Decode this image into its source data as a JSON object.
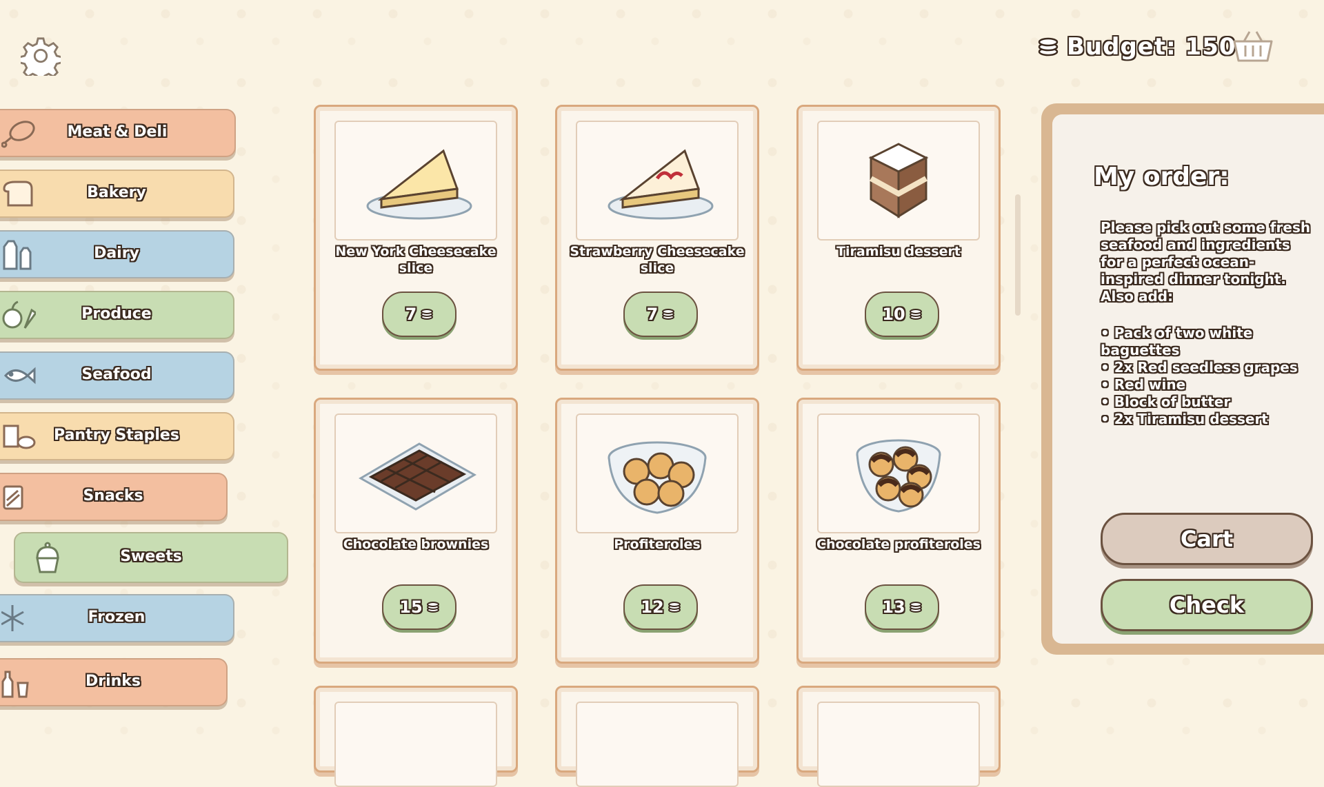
{
  "header": {
    "budget_label": "Budget: 150",
    "settings_icon": "gear-icon",
    "cart_icon": "basket-icon",
    "coin_icon": "coins-icon"
  },
  "categories": [
    {
      "label": "Meat & Deli",
      "icon": "meat-icon",
      "color": "#f3bfa0"
    },
    {
      "label": "Bakery",
      "icon": "bread-icon",
      "color": "#f8dcae"
    },
    {
      "label": "Dairy",
      "icon": "milk-icon",
      "color": "#b6d3e3"
    },
    {
      "label": "Produce",
      "icon": "apple-carrot-icon",
      "color": "#c8ddb3"
    },
    {
      "label": "Seafood",
      "icon": "fish-icon",
      "color": "#b6d3e3"
    },
    {
      "label": "Pantry Staples",
      "icon": "pantry-icon",
      "color": "#f8dcae"
    },
    {
      "label": "Snacks",
      "icon": "snack-icon",
      "color": "#f3bfa0"
    },
    {
      "label": "Sweets",
      "icon": "cupcake-icon",
      "color": "#c8ddb3",
      "selected": true
    },
    {
      "label": "Frozen",
      "icon": "snowflake-icon",
      "color": "#b6d3e3"
    },
    {
      "label": "Drinks",
      "icon": "bottles-icon",
      "color": "#f3bfa0"
    }
  ],
  "products": [
    {
      "name": "New York Cheesecake slice",
      "price": "7",
      "icon": "cheesecake-icon"
    },
    {
      "name": "Strawberry Cheesecake slice",
      "price": "7",
      "icon": "strawberry-cheesecake-icon"
    },
    {
      "name": "Tiramisu dessert",
      "price": "10",
      "icon": "tiramisu-icon"
    },
    {
      "name": "Chocolate brownies",
      "price": "15",
      "icon": "brownies-icon"
    },
    {
      "name": "Profiteroles",
      "price": "12",
      "icon": "profiteroles-icon"
    },
    {
      "name": "Chocolate profiteroles",
      "price": "13",
      "icon": "chocolate-profiteroles-icon"
    }
  ],
  "order": {
    "title": "My order:",
    "description": "Please pick out some fresh seafood and ingredients for a perfect ocean-inspired dinner tonight. Also add:",
    "items": [
      "Pack of two white baguettes",
      "2x Red seedless grapes",
      "Red wine",
      "Block of butter",
      "2x Tiramisu dessert"
    ],
    "cart_label": "Cart",
    "check_label": "Check"
  },
  "colors": {
    "background": "#faf3e3",
    "accent_green": "#c8ddb3",
    "card_border": "#d9a87e"
  }
}
